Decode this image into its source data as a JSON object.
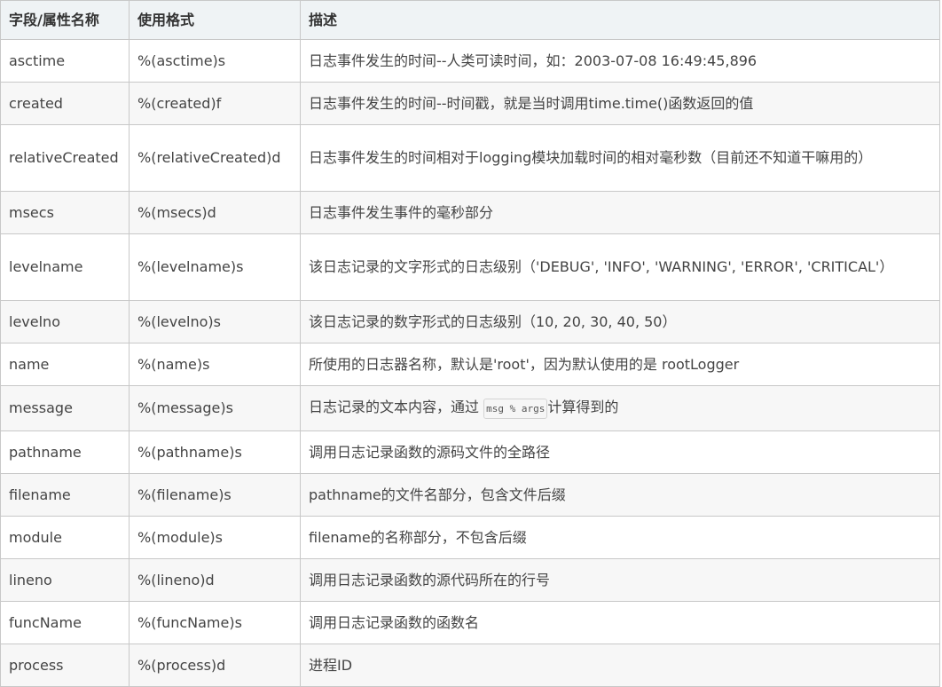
{
  "table": {
    "headers": [
      "字段/属性名称",
      "使用格式",
      "描述"
    ],
    "rows": [
      {
        "name": "asctime",
        "format": "%(asctime)s",
        "desc": "日志事件发生的时间--人类可读时间，如：2003-07-08 16:49:45,896"
      },
      {
        "name": "created",
        "format": "%(created)f",
        "desc": "日志事件发生的时间--时间戳，就是当时调用time.time()函数返回的值"
      },
      {
        "name": "relativeCreated",
        "format": "%(relativeCreated)d",
        "desc": "日志事件发生的时间相对于logging模块加载时间的相对毫秒数（目前还不知道干嘛用的）"
      },
      {
        "name": "msecs",
        "format": "%(msecs)d",
        "desc": "日志事件发生事件的毫秒部分"
      },
      {
        "name": "levelname",
        "format": "%(levelname)s",
        "desc": "该日志记录的文字形式的日志级别（'DEBUG', 'INFO', 'WARNING', 'ERROR', 'CRITICAL'）"
      },
      {
        "name": "levelno",
        "format": "%(levelno)s",
        "desc": "该日志记录的数字形式的日志级别（10, 20, 30, 40, 50）"
      },
      {
        "name": "name",
        "format": "%(name)s",
        "desc": "所使用的日志器名称，默认是'root'，因为默认使用的是 rootLogger"
      },
      {
        "name": "message",
        "format": "%(message)s",
        "desc_before": "日志记录的文本内容，通过 ",
        "desc_code": "msg % args",
        "desc_after": "计算得到的"
      },
      {
        "name": "pathname",
        "format": "%(pathname)s",
        "desc": "调用日志记录函数的源码文件的全路径"
      },
      {
        "name": "filename",
        "format": "%(filename)s",
        "desc": "pathname的文件名部分，包含文件后缀"
      },
      {
        "name": "module",
        "format": "%(module)s",
        "desc": "filename的名称部分，不包含后缀"
      },
      {
        "name": "lineno",
        "format": "%(lineno)d",
        "desc": "调用日志记录函数的源代码所在的行号"
      },
      {
        "name": "funcName",
        "format": "%(funcName)s",
        "desc": "调用日志记录函数的函数名"
      },
      {
        "name": "process",
        "format": "%(process)d",
        "desc": "进程ID"
      }
    ]
  }
}
